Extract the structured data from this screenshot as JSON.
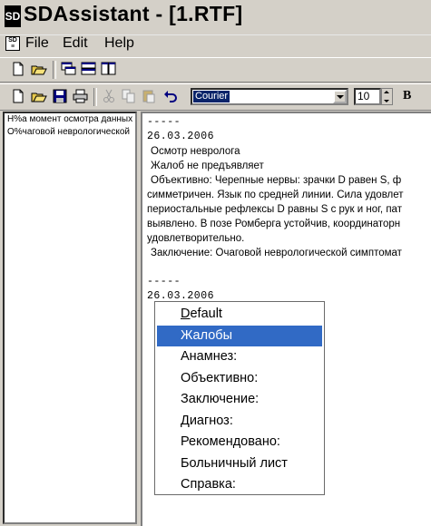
{
  "window": {
    "logo_text": "SD",
    "title": "SDAssistant - [1.RTF]"
  },
  "menubar": {
    "items": [
      {
        "label": "File"
      },
      {
        "label": "Edit"
      },
      {
        "label": "Help"
      }
    ]
  },
  "toolbar1": {
    "buttons": [
      "new-icon",
      "open-icon",
      "cascade-icon",
      "tile-horizontal-icon",
      "tile-vertical-icon"
    ]
  },
  "toolbar2": {
    "buttons": [
      "new-icon",
      "open-icon",
      "save-icon",
      "print-icon",
      "cut-icon",
      "copy-icon",
      "paste-icon",
      "undo-icon"
    ],
    "font_name": "Courier",
    "font_size": "10",
    "bold_label": "B"
  },
  "left_pane": {
    "items": [
      "Н%а момент осмотра данных",
      "О%чаговой неврологической"
    ]
  },
  "document": {
    "block1": {
      "separator": "-----",
      "date": "26.03.2006",
      "heading": "Осмотр невролога",
      "line1": "Жалоб не предъявляет",
      "line2": "Объективно: Черепные нервы: зрачки D равен S, ф",
      "line3": "симметричен. Язык по средней линии. Сила удовлет",
      "line4": "периостальные рефлексы D равны S с рук и ног, пат",
      "line5": "выявлено. В позе Ромберга устойчив, координаторн",
      "line6": "удовлетворительно.",
      "line7": "Заключение: Очаговой неврологической симптомат"
    },
    "block2": {
      "separator": "-----",
      "date": "26.03.2006"
    }
  },
  "popup_menu": {
    "items": [
      {
        "label": "Default",
        "selected": false
      },
      {
        "label": "Жалобы",
        "selected": true
      },
      {
        "label": "Анамнез:",
        "selected": false
      },
      {
        "label": "Объективно:",
        "selected": false
      },
      {
        "label": "Заключение:",
        "selected": false
      },
      {
        "label": "Диагноз:",
        "selected": false
      },
      {
        "label": "Рекомендовано:",
        "selected": false
      },
      {
        "label": "Больничный лист",
        "selected": false
      },
      {
        "label": "Справка:",
        "selected": false
      }
    ]
  },
  "colors": {
    "chrome": "#d4d0c8",
    "selection": "#316ac5",
    "combo_selection": "#0a246a"
  }
}
